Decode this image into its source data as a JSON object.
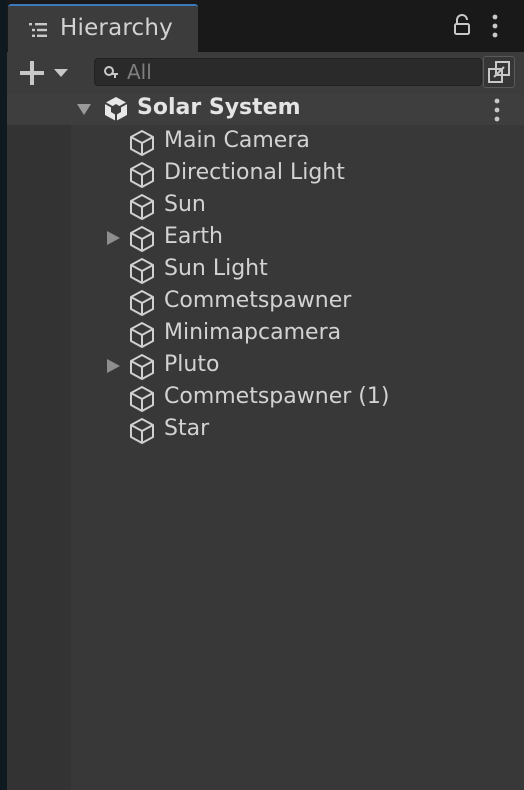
{
  "tab": {
    "title": "Hierarchy",
    "icon": "hierarchy-list-icon"
  },
  "toolbar": {
    "add_icon": "plus-dropdown-icon",
    "search": {
      "value": "",
      "placeholder": "All",
      "icon": "search-icon"
    },
    "scene_filter_icon": "scene-filter-icon"
  },
  "scene": {
    "name": "Solar System",
    "expanded": true,
    "icon": "unity-scene-icon"
  },
  "objects": [
    {
      "name": "Main Camera",
      "has_children": false
    },
    {
      "name": "Directional Light",
      "has_children": false
    },
    {
      "name": "Sun",
      "has_children": false
    },
    {
      "name": "Earth",
      "has_children": true
    },
    {
      "name": "Sun Light",
      "has_children": false
    },
    {
      "name": "Commetspawner",
      "has_children": false
    },
    {
      "name": "Minimapcamera",
      "has_children": false
    },
    {
      "name": "Pluto",
      "has_children": true
    },
    {
      "name": "Commetspawner (1)",
      "has_children": false
    },
    {
      "name": "Star",
      "has_children": false
    }
  ],
  "colors": {
    "tab_accent": "#3a79bb",
    "panel_bg": "#383838",
    "text": "#d2d2d2"
  }
}
